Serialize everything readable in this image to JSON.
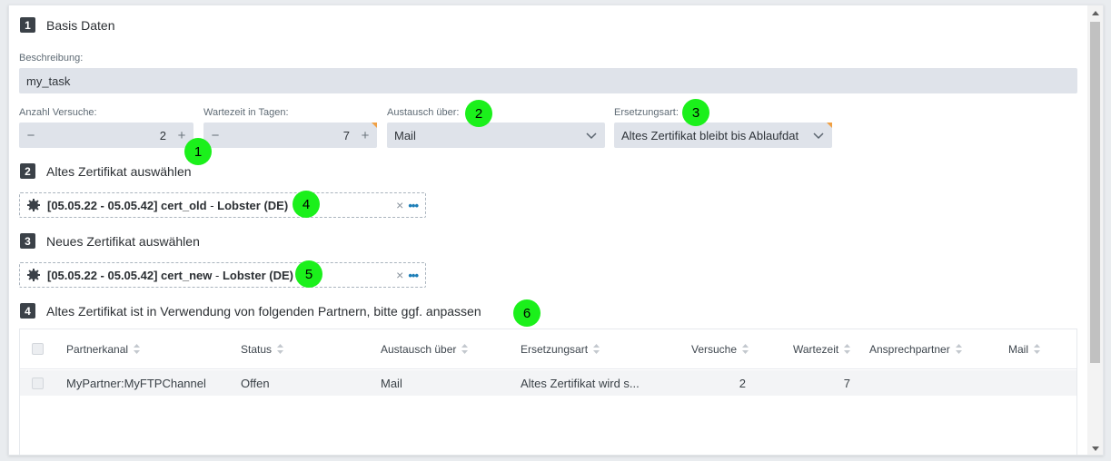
{
  "sections": {
    "s1": {
      "num": "1",
      "title": "Basis Daten"
    },
    "s2": {
      "num": "2",
      "title": "Altes Zertifikat auswählen"
    },
    "s3": {
      "num": "3",
      "title": "Neues Zertifikat auswählen"
    },
    "s4": {
      "num": "4",
      "title": "Altes Zertifikat ist in Verwendung von folgenden Partnern, bitte ggf. anpassen"
    }
  },
  "form": {
    "beschreibung": {
      "label": "Beschreibung:",
      "value": "my_task"
    },
    "versuche": {
      "label": "Anzahl Versuche:",
      "value": "2",
      "minus": "−",
      "plus": "+"
    },
    "wartezeit": {
      "label": "Wartezeit in Tagen:",
      "value": "7",
      "minus": "−",
      "plus": "+"
    },
    "austausch": {
      "label": "Austausch über:",
      "value": "Mail"
    },
    "ersetzung": {
      "label": "Ersetzungsart:",
      "value": "Altes Zertifikat bleibt bis Ablaufdat"
    }
  },
  "certs": {
    "old": {
      "range": "[05.05.22 - 05.05.42] cert_old",
      "sep": " - ",
      "owner": "Lobster (DE)",
      "remove": "×",
      "more": "•••"
    },
    "new": {
      "range": "[05.05.22 - 05.05.42] cert_new",
      "sep": " - ",
      "owner": "Lobster (DE)",
      "remove": "×",
      "more": "•••"
    }
  },
  "markers": [
    "1",
    "2",
    "3",
    "4",
    "5",
    "6"
  ],
  "table": {
    "columns": [
      "Partnerkanal",
      "Status",
      "Austausch über",
      "Ersetzungsart",
      "Versuche",
      "Wartezeit",
      "Ansprechpartner",
      "Mail"
    ],
    "rows": [
      {
        "partnerkanal": "MyPartner:MyFTPChannel",
        "status": "Offen",
        "austausch": "Mail",
        "ersetzung": "Altes Zertifikat wird s...",
        "versuche": "2",
        "wartezeit": "7",
        "ansprechpartner": "",
        "mail": ""
      }
    ]
  },
  "colors": {
    "accent": "#1e7fb8",
    "marker": "#1bf01b",
    "field_bg": "#dfe3ea",
    "corner": "#f0a044"
  }
}
